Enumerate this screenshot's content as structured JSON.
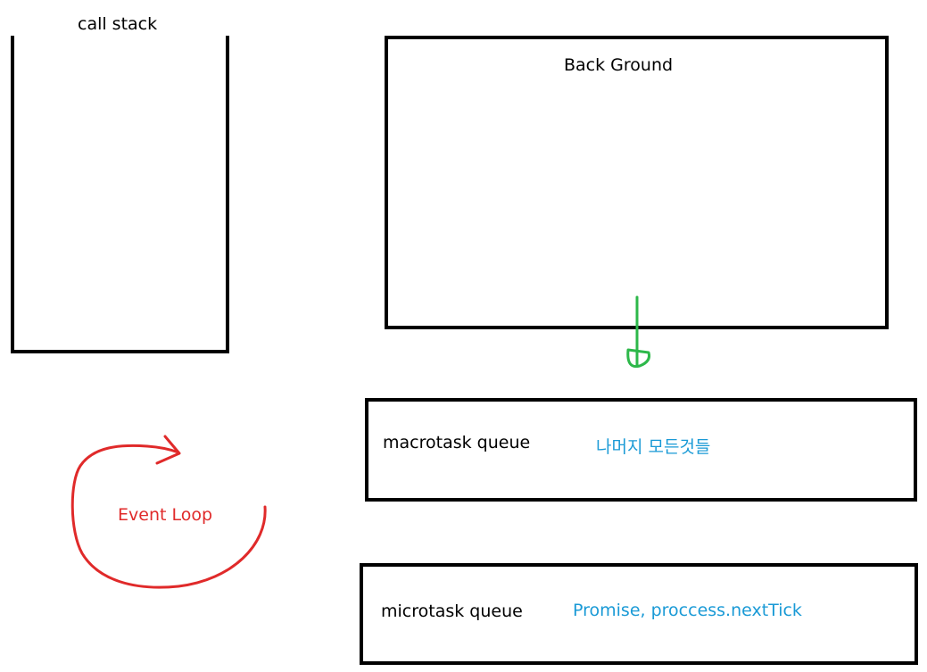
{
  "call_stack": {
    "label": "call stack"
  },
  "background": {
    "label": "Back Ground"
  },
  "macrotask": {
    "label": "macrotask queue",
    "note": "나머지 모든것들"
  },
  "microtask": {
    "label": "microtask queue",
    "note": "Promise, proccess.nextTick"
  },
  "event_loop": {
    "label": "Event Loop"
  },
  "colors": {
    "arrow_green": "#2db84a",
    "loop_red": "#e02a2a",
    "note_blue": "#1a9ad6"
  }
}
